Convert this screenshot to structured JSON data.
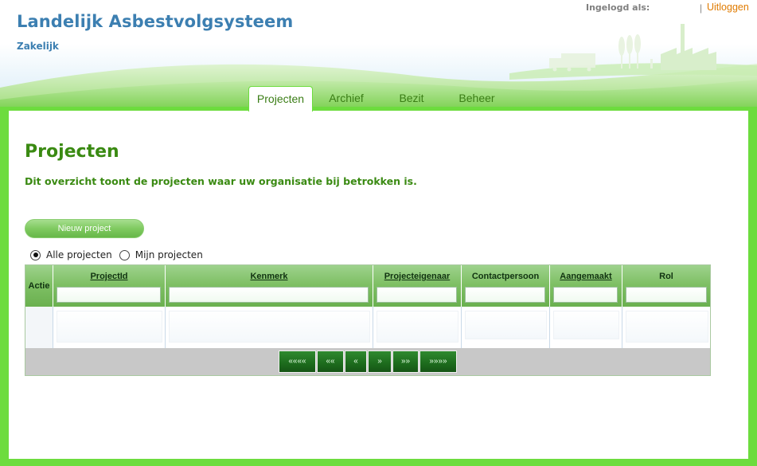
{
  "header": {
    "app_title": "Landelijk Asbestvolgsysteem",
    "subtitle": "Zakelijk",
    "login_label": "Ingelogd als:",
    "separator": "|",
    "logout": "Uitloggen"
  },
  "tabs": [
    {
      "label": "Projecten",
      "active": true
    },
    {
      "label": "Archief",
      "active": false
    },
    {
      "label": "Bezit",
      "active": false
    },
    {
      "label": "Beheer",
      "active": false
    }
  ],
  "main": {
    "title": "Projecten",
    "description": "Dit overzicht toont de projecten waar uw organisatie bij betrokken is.",
    "new_button": "Nieuw project",
    "filter": {
      "options": [
        {
          "label": "Alle projecten",
          "checked": true
        },
        {
          "label": "Mijn projecten",
          "checked": false
        }
      ]
    }
  },
  "grid": {
    "columns": [
      {
        "label": "Actie",
        "sortable": false,
        "filter": false
      },
      {
        "label": "ProjectId",
        "sortable": true,
        "filter": true
      },
      {
        "label": "Kenmerk",
        "sortable": true,
        "filter": true
      },
      {
        "label": "Projecteigenaar",
        "sortable": true,
        "filter": true
      },
      {
        "label": "Contactpersoon",
        "sortable": false,
        "filter": true
      },
      {
        "label": "Aangemaakt",
        "sortable": true,
        "filter": true
      },
      {
        "label": "Rol",
        "sortable": false,
        "filter": true
      }
    ],
    "rows": [],
    "pager": [
      "««««",
      "««",
      "«",
      "»",
      "»»",
      "»»»»"
    ]
  },
  "colors": {
    "brand_blue": "#3c7fb1",
    "title_green": "#3a8a12",
    "frame_green": "#6ddc3e",
    "logout_orange": "#e07b00"
  }
}
